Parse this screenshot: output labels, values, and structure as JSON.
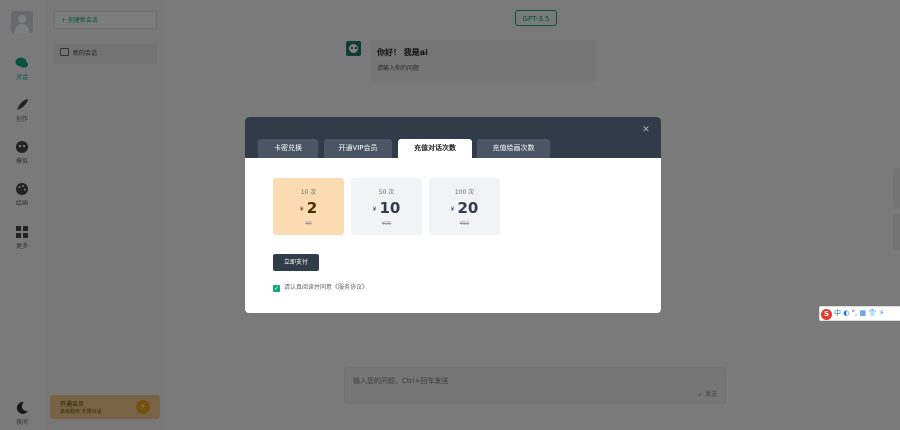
{
  "sidebar": {
    "items": [
      {
        "label": "对话",
        "icon": "chat-icon",
        "active": true
      },
      {
        "label": "创作",
        "icon": "feather-icon",
        "active": false
      },
      {
        "label": "模拟",
        "icon": "robot-icon",
        "active": false
      },
      {
        "label": "绘画",
        "icon": "palette-icon",
        "active": false
      },
      {
        "label": "更多",
        "icon": "grid-icon",
        "active": false
      }
    ],
    "theme_label": "夜间",
    "theme_icon": "moon-icon"
  },
  "conversations": {
    "new_chat_label": "+ 创建新会话",
    "items": [
      {
        "label": "新的会话"
      }
    ]
  },
  "vip_banner": {
    "title": "开通会员",
    "subtitle": "高级服务 无限对话",
    "icon": "bolt-icon"
  },
  "main": {
    "model": "GPT-3.5",
    "greeting": {
      "title": "你好！ 我是ai",
      "subtitle": "请输入你的问题"
    },
    "input": {
      "placeholder": "输入您的问题，Ctrl+回车发送",
      "send_label": "发送",
      "send_icon": "send-icon"
    }
  },
  "modal": {
    "tabs": [
      {
        "label": "卡密兑换",
        "active": false
      },
      {
        "label": "开通VIP会员",
        "active": false
      },
      {
        "label": "充值对话次数",
        "active": true
      },
      {
        "label": "充值绘画次数",
        "active": false
      }
    ],
    "currency": "¥",
    "plans": [
      {
        "count": "10 次",
        "price": "2",
        "original": "¥5",
        "selected": true
      },
      {
        "count": "50 次",
        "price": "10",
        "original": "¥25",
        "selected": false
      },
      {
        "count": "100 次",
        "price": "20",
        "original": "¥50",
        "selected": false
      }
    ],
    "pay_label": "立即支付",
    "agreement": "请认真阅读并同意《服务协议》",
    "agreement_checked": true
  },
  "ime_toolbar": {
    "logo": "S",
    "items": "中 ◐ °, ▦ 👕 ⚡"
  },
  "colors": {
    "accent": "#13a57a",
    "modal_header": "#323b4a",
    "selected_plan": "#fbdcb2",
    "vip": "#f0c989"
  }
}
